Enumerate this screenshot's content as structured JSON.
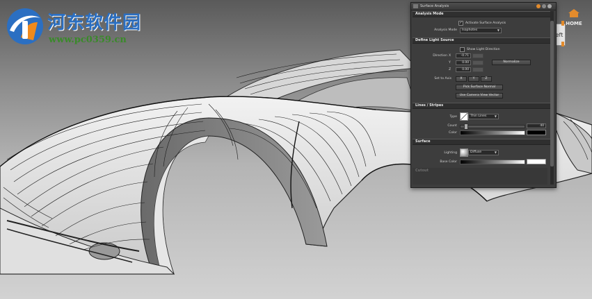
{
  "watermark": {
    "title": "河东软件园",
    "url": "www.pc0359.cn"
  },
  "viewcube": {
    "home_label": "HOME",
    "side_label": "eft"
  },
  "panel": {
    "title": "Surface Analysis",
    "sections": {
      "analysis_mode": {
        "header": "Analysis Mode",
        "activate_label": "Activate Surface Analysis",
        "activate_checked": true,
        "mode_label": "Analysis Mode",
        "mode_value": "Isophotes"
      },
      "light_source": {
        "header": "Define Light Source",
        "show_label": "Show Light Direction",
        "direction_label": "Direction",
        "axes": [
          "X",
          "Y",
          "Z"
        ],
        "values": [
          "-0.71",
          "0.00",
          "0.00"
        ],
        "normalize_button": "Normalize",
        "set_to_axis_label": "Set to Axis",
        "axis_buttons": [
          "X",
          "Y",
          "Z"
        ],
        "pick_button": "Pick Surface Normal",
        "camera_button": "Use Camera View Vector"
      },
      "lines": {
        "header": "Lines / Stripes",
        "type_label": "Type",
        "type_value": "Thin Lines",
        "count_label": "Count",
        "count_value": "40",
        "count_fraction": 0.06,
        "color_label": "Color",
        "color_hex": "#000000"
      },
      "surface": {
        "header": "Surface",
        "lighting_label": "Lighting",
        "lighting_value": "Diffuse",
        "base_color_label": "Base Color",
        "base_color_hex": "#ffffff"
      },
      "collapsed": {
        "header": "Cutout"
      }
    }
  },
  "colors": {
    "watermark_blue": "#2b6fc2",
    "watermark_green": "#3a8a2a",
    "accent_orange": "#e38b2c"
  }
}
